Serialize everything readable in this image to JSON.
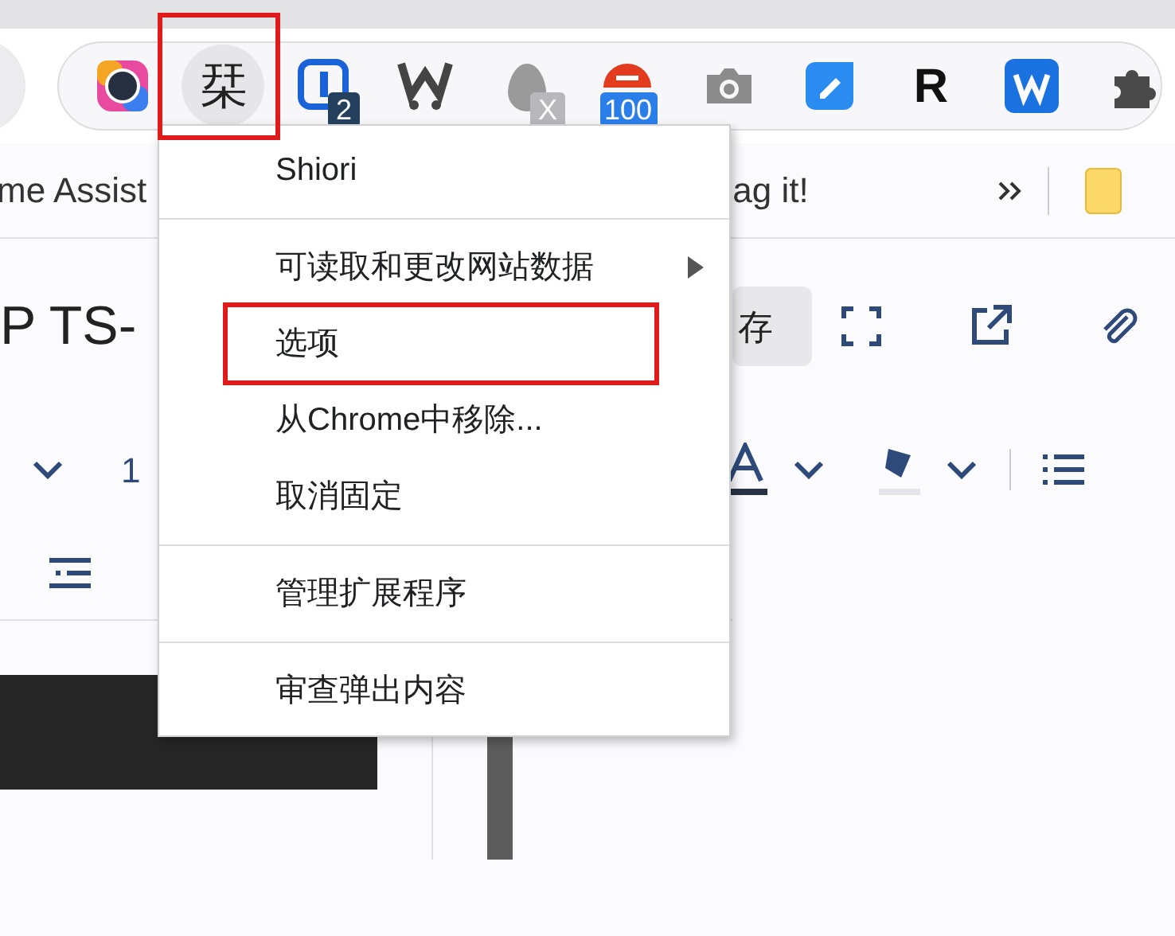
{
  "toolbar": {
    "extensions": [
      {
        "kind": "ring",
        "annotated": false
      },
      {
        "kind": "char",
        "label": "栞",
        "annotated": true
      },
      {
        "kind": "key",
        "badge": "2",
        "annotated": false
      },
      {
        "kind": "w",
        "annotated": false
      },
      {
        "kind": "egg",
        "badge": "X",
        "annotated": false
      },
      {
        "kind": "red",
        "badge": "100",
        "annotated": false
      },
      {
        "kind": "camera",
        "annotated": false
      },
      {
        "kind": "tag",
        "annotated": false
      },
      {
        "kind": "char",
        "label": "R",
        "annotated": false
      },
      {
        "kind": "wblue",
        "annotated": false
      },
      {
        "kind": "puzzle",
        "annotated": false
      }
    ]
  },
  "bookmarks": [
    "me Assist",
    "ag it!"
  ],
  "document": {
    "title": "P TS-",
    "save_button": "存",
    "font_size": "1"
  },
  "menu": {
    "items": [
      {
        "kind": "header",
        "label": "Shiori"
      },
      {
        "kind": "separator"
      },
      {
        "kind": "submenu",
        "label": "可读取和更改网站数据",
        "annotated": false
      },
      {
        "kind": "item",
        "label": "选项",
        "annotated": true
      },
      {
        "kind": "item",
        "label": "从Chrome中移除...",
        "annotated": false
      },
      {
        "kind": "item",
        "label": "取消固定",
        "annotated": false
      },
      {
        "kind": "separator"
      },
      {
        "kind": "item",
        "label": "管理扩展程序",
        "annotated": false
      },
      {
        "kind": "separator"
      },
      {
        "kind": "item",
        "label": "审查弹出内容",
        "annotated": false
      }
    ]
  }
}
